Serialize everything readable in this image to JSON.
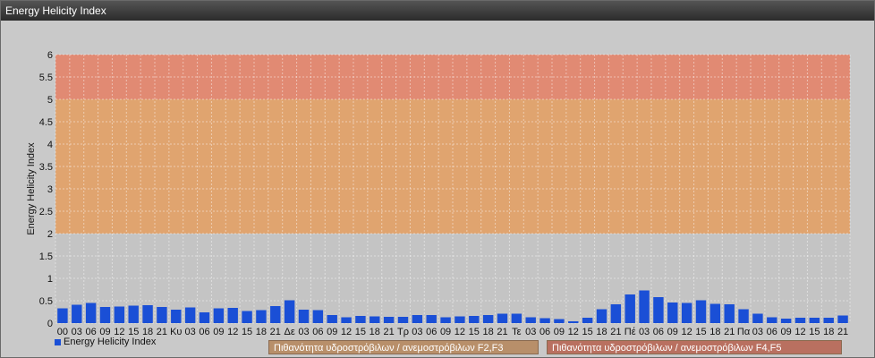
{
  "window": {
    "title": "Energy Helicity Index"
  },
  "legend": {
    "series_label": "Energy Helicity Index"
  },
  "risk_labels": [
    "Πιθανότητα υδροστρόβιλων / ανεμοστρόβιλων F2,F3",
    "Πιθανότητα υδροστρόβιλων / ανεμοστρόβιλων F4,F5"
  ],
  "colors": {
    "bar": "#1a4fd6",
    "band_low": "#c4c4c4",
    "band_mid": "#e0a46f",
    "band_high": "#e18a73"
  },
  "chart_data": {
    "type": "bar",
    "title": "",
    "ylabel": "Energy Helicity Index",
    "xlabel": "",
    "ylim": [
      0,
      6
    ],
    "yticks": [
      "0",
      "0.5",
      "1",
      "1.5",
      "2",
      "2.5",
      "3",
      "3.5",
      "4",
      "4.5",
      "5",
      "5.5",
      "6"
    ],
    "bands": [
      {
        "from": 0,
        "to": 2
      },
      {
        "from": 2,
        "to": 5
      },
      {
        "from": 5,
        "to": 6
      }
    ],
    "grid": true,
    "legend_position": "bottom-left",
    "categories": [
      "00",
      "03",
      "06",
      "09",
      "12",
      "15",
      "18",
      "21",
      "Κυ",
      "03",
      "06",
      "09",
      "12",
      "15",
      "18",
      "21",
      "Δε",
      "03",
      "06",
      "09",
      "12",
      "15",
      "18",
      "21",
      "Τρ",
      "03",
      "06",
      "09",
      "12",
      "15",
      "18",
      "21",
      "Τε",
      "03",
      "06",
      "09",
      "12",
      "15",
      "18",
      "21",
      "Πέ",
      "03",
      "06",
      "09",
      "12",
      "15",
      "18",
      "21",
      "Πα",
      "03",
      "06",
      "09",
      "12",
      "15",
      "18",
      "21"
    ],
    "series": [
      {
        "name": "Energy Helicity Index",
        "values": [
          0.33,
          0.41,
          0.45,
          0.36,
          0.37,
          0.39,
          0.4,
          0.36,
          0.3,
          0.35,
          0.24,
          0.33,
          0.34,
          0.27,
          0.29,
          0.38,
          0.51,
          0.3,
          0.29,
          0.18,
          0.13,
          0.16,
          0.15,
          0.14,
          0.14,
          0.18,
          0.18,
          0.13,
          0.15,
          0.16,
          0.18,
          0.21,
          0.21,
          0.13,
          0.11,
          0.09,
          0.04,
          0.12,
          0.31,
          0.42,
          0.64,
          0.73,
          0.58,
          0.46,
          0.45,
          0.51,
          0.43,
          0.42,
          0.31,
          0.21,
          0.13,
          0.1,
          0.12,
          0.12,
          0.12,
          0.17
        ]
      }
    ]
  }
}
